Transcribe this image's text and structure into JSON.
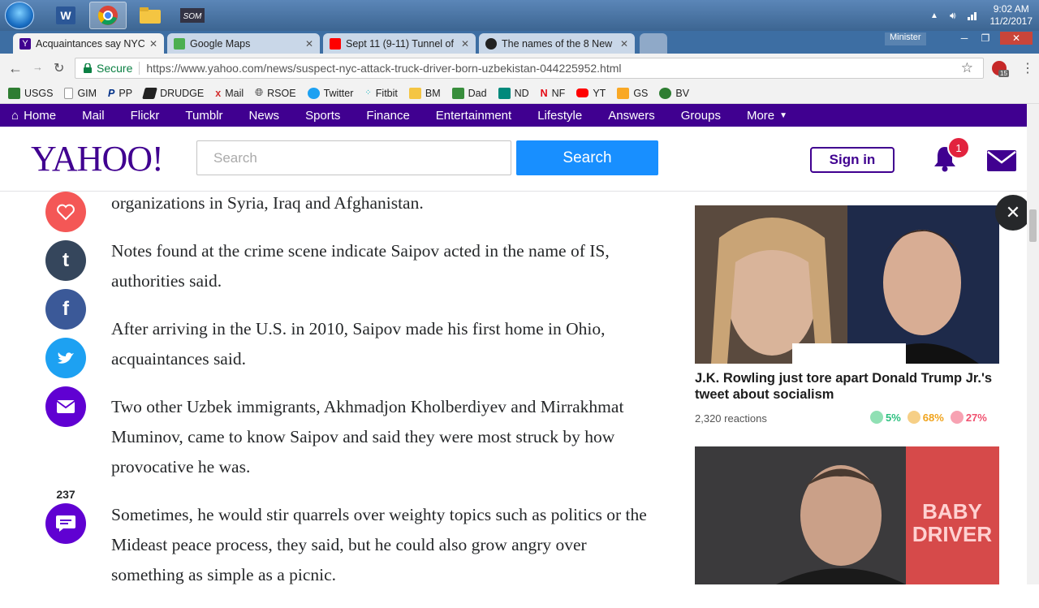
{
  "taskbar": {
    "apps": [
      {
        "name": "start-button"
      },
      {
        "name": "word-app"
      },
      {
        "name": "chrome-app"
      },
      {
        "name": "explorer-app"
      },
      {
        "name": "som-app"
      }
    ],
    "time": "9:02 AM",
    "date": "11/2/2017"
  },
  "tabs": [
    {
      "title": "Acquaintances say NYC s",
      "active": true,
      "favicon_color": "#400090"
    },
    {
      "title": "Google Maps",
      "active": false,
      "favicon_color": "#4caf50"
    },
    {
      "title": "Sept 11 (9-11) Tunnel of",
      "active": false,
      "favicon_color": "#ff0000"
    },
    {
      "title": "The names of the 8 New",
      "active": false,
      "favicon_color": "#222222"
    }
  ],
  "window": {
    "profile_label": "Minister"
  },
  "omnibox": {
    "secure_label": "Secure",
    "url": "https://www.yahoo.com/news/suspect-nyc-attack-truck-driver-born-uzbekistan-044225952.html",
    "extension_badge": "15"
  },
  "bookmarks": [
    {
      "label": "USGS",
      "icon": "usgs-icon",
      "color": "#2e7d32"
    },
    {
      "label": "GIM",
      "icon": "page-icon",
      "color": "#9e9e9e"
    },
    {
      "label": "PP",
      "icon": "paypal-icon",
      "color": "#003087"
    },
    {
      "label": "DRUDGE",
      "icon": "drudge-icon",
      "color": "#222222"
    },
    {
      "label": "Mail",
      "icon": "mail-icon",
      "color": "#d32f2f"
    },
    {
      "label": "RSOE",
      "icon": "globe-icon",
      "color": "#333333"
    },
    {
      "label": "Twitter",
      "icon": "twitter-icon",
      "color": "#1da1f2"
    },
    {
      "label": "Fitbit",
      "icon": "fitbit-icon",
      "color": "#00b0b9"
    },
    {
      "label": "BM",
      "icon": "folder-icon",
      "color": "#f4c542"
    },
    {
      "label": "Dad",
      "icon": "dad-icon",
      "color": "#388e3c"
    },
    {
      "label": "ND",
      "icon": "nd-icon",
      "color": "#00897b"
    },
    {
      "label": "NF",
      "icon": "netflix-icon",
      "color": "#e50914"
    },
    {
      "label": "YT",
      "icon": "youtube-icon",
      "color": "#ff0000"
    },
    {
      "label": "GS",
      "icon": "gs-icon",
      "color": "#f9a825"
    },
    {
      "label": "BV",
      "icon": "bv-icon",
      "color": "#2e7d32"
    }
  ],
  "yahoo_nav": [
    "Home",
    "Mail",
    "Flickr",
    "Tumblr",
    "News",
    "Sports",
    "Finance",
    "Entertainment",
    "Lifestyle",
    "Answers",
    "Groups",
    "More"
  ],
  "header": {
    "logo": "YAHOO!",
    "search_placeholder": "Search",
    "search_button": "Search",
    "sign_in": "Sign in",
    "notification_count": "1"
  },
  "article": {
    "paragraphs": [
      "organizations in Syria, Iraq and Afghanistan.",
      "Notes found at the crime scene indicate Saipov acted in the name of IS, authorities said.",
      "After arriving in the U.S. in 2010, Saipov made his first home in Ohio, acquaintances said.",
      "Two other Uzbek immigrants, Akhmadjon Kholberdiyev and Mirrakhmat Muminov, came to know Saipov and said they were most struck by how provocative he was.",
      "Sometimes, he would stir quarrels over weighty topics such as politics or the Mideast peace process, they said, but he could also grow angry over something as simple as a picnic."
    ],
    "comment_count": "237"
  },
  "share": [
    {
      "name": "heart-icon",
      "color": "#f45756"
    },
    {
      "name": "tumblr-icon",
      "color": "#35465c"
    },
    {
      "name": "facebook-icon",
      "color": "#3b5998"
    },
    {
      "name": "twitter-icon",
      "color": "#1da1f2"
    },
    {
      "name": "email-icon",
      "color": "#6001d2"
    }
  ],
  "rail": {
    "story1_title": "J.K. Rowling just tore apart Donald Trump Jr.'s tweet about socialism",
    "story1_reactions": "2,320 reactions",
    "emoji_happy": "5%",
    "emoji_neutral": "68%",
    "emoji_sad": "27%",
    "story2_poster_text": "BABY DRIVER"
  }
}
